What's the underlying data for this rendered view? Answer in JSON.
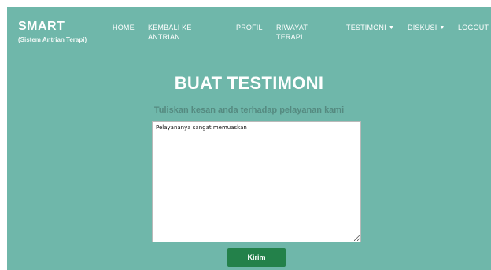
{
  "navbar": {
    "brand": {
      "name": "SMART",
      "subtitle": "(Sistem Antrian Terapi)"
    },
    "items": [
      {
        "label": "HOME"
      },
      {
        "label": "KEMBALI KE ANTRIAN"
      },
      {
        "label": "PROFIL"
      },
      {
        "label": "RIWAYAT TERAPI"
      },
      {
        "label": "TESTIMONI",
        "icon": "caret-down-icon"
      },
      {
        "label": "DISKUSI",
        "icon": "caret-down-icon"
      },
      {
        "label": "LOGOUT"
      }
    ]
  },
  "main": {
    "title": "BUAT TESTIMONI",
    "subtitle": "Tuliskan kesan anda terhadap pelayanan kami",
    "textarea_value": "Pelayananya sangat memuaskan",
    "submit_label": "Kirim"
  },
  "colors": {
    "background": "#6fb7aa",
    "submit_button": "#23814a",
    "subtitle_text": "#558a80"
  }
}
